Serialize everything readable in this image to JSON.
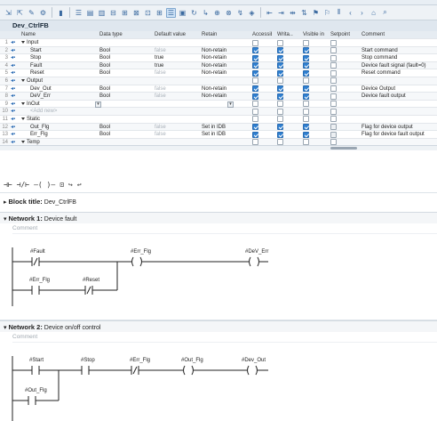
{
  "block_name": "Dev_CtrlFB",
  "columns": {
    "name": "Name",
    "data_type": "Data type",
    "default": "Default value",
    "retain": "Retain",
    "accessible": "Accessible f...",
    "writable": "Writa...",
    "visible": "Visible in ...",
    "setpoint": "Setpoint",
    "comment": "Comment"
  },
  "rows": [
    {
      "num": "1",
      "name": "Input",
      "section": true
    },
    {
      "num": "2",
      "name": "Start",
      "type": "Bool",
      "default": "false",
      "retain": "Non-retain",
      "comment": "Start command"
    },
    {
      "num": "3",
      "name": "Stop",
      "type": "Bool",
      "default": "true",
      "retain": "Non-retain",
      "comment": "Stop command"
    },
    {
      "num": "4",
      "name": "Fault",
      "type": "Bool",
      "default": "true",
      "retain": "Non-retain",
      "comment": "Device fault signal (fault=0)"
    },
    {
      "num": "5",
      "name": "Reset",
      "type": "Bool",
      "default": "false",
      "retain": "Non-retain",
      "comment": "Reset command"
    },
    {
      "num": "6",
      "name": "Output",
      "section": true
    },
    {
      "num": "7",
      "name": "Dev_Out",
      "type": "Bool",
      "default": "false",
      "retain": "Non-retain",
      "comment": "Device Output"
    },
    {
      "num": "8",
      "name": "DeV_Err",
      "type": "Bool",
      "default": "false",
      "retain": "Non-retain",
      "comment": "Device fault output"
    },
    {
      "num": "9",
      "name": "InOut",
      "section": true
    },
    {
      "num": "10",
      "name": "<Add new>",
      "addnew": true
    },
    {
      "num": "11",
      "name": "Static",
      "section": true
    },
    {
      "num": "12",
      "name": "Out_Flg",
      "type": "Bool",
      "default": "false",
      "retain": "Set in IDB",
      "comment": "Flag for device output"
    },
    {
      "num": "13",
      "name": "Err_Flg",
      "type": "Bool",
      "default": "false",
      "retain": "Set in IDB",
      "comment": "Flag for device fault output"
    },
    {
      "num": "14",
      "name": "Temp",
      "section": true
    }
  ],
  "block_title_label": "Block title:",
  "block_title_value": "Dev_CtrlFB",
  "network1": {
    "label": "Network 1:",
    "title": "Device fault",
    "comment": "Comment",
    "tags": {
      "fault": "#Fault",
      "err_flg_coil": "#Err_Flg",
      "dev_err": "#DeV_Err",
      "err_flg_contact": "#Err_Flg",
      "reset": "#Reset"
    }
  },
  "network2": {
    "label": "Network 2:",
    "title": "Device on/off control",
    "comment": "Comment",
    "tags": {
      "start": "#Start",
      "stop": "#Stop",
      "err_flg": "#Err_Flg",
      "out_flg_coil": "#Out_Flg",
      "dev_out": "#Dev_Out",
      "out_flg_contact": "#Out_Flg"
    }
  },
  "icons": [
    "insert-row-icon",
    "delete-row-icon",
    "network-icon",
    "contact-no-icon",
    "contact-nc-icon",
    "coil-icon",
    "box-icon",
    "branch-open-icon",
    "branch-close-icon"
  ]
}
